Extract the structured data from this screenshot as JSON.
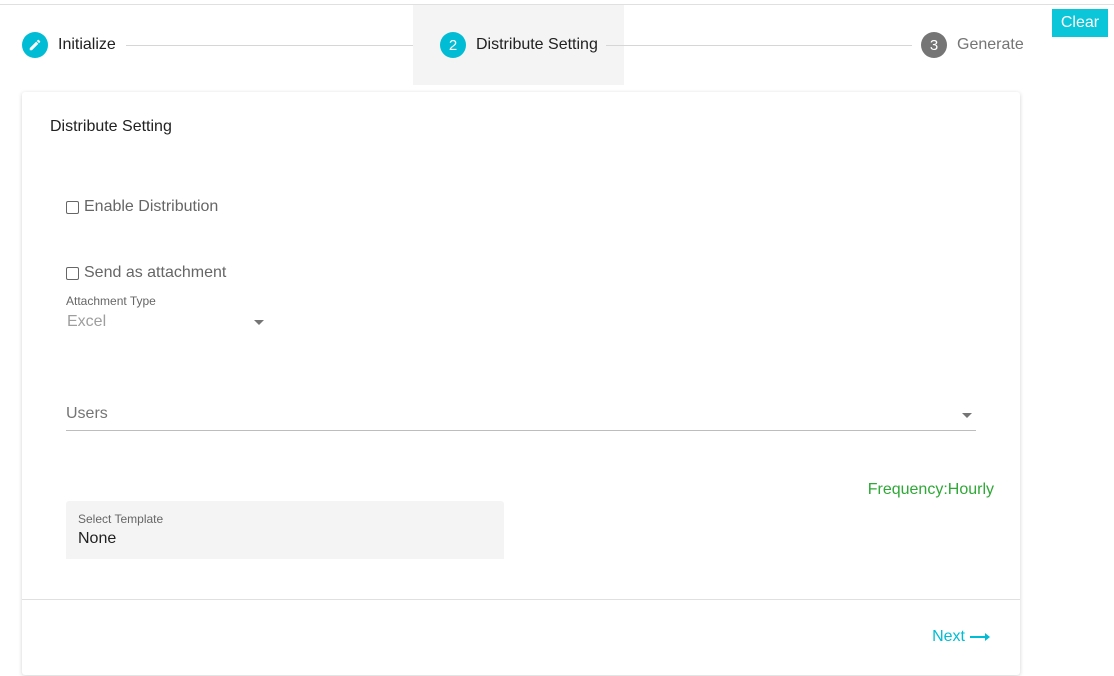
{
  "stepper": {
    "steps": [
      {
        "label": "Initialize",
        "badge": "",
        "icon": "pencil-icon",
        "state": "completed"
      },
      {
        "label": "Distribute Setting",
        "badge": "2",
        "state": "active"
      },
      {
        "label": "Generate",
        "badge": "3",
        "state": "inactive"
      }
    ]
  },
  "toolbar": {
    "clear_label": "Clear"
  },
  "card": {
    "title": "Distribute Setting",
    "enable_distribution": {
      "label": "Enable Distribution",
      "checked": false
    },
    "send_as_attachment": {
      "label": "Send as attachment",
      "checked": false
    },
    "attachment_type": {
      "label": "Attachment Type",
      "value": "Excel"
    },
    "users": {
      "placeholder": "Users"
    },
    "frequency": "Frequency:Hourly",
    "template": {
      "label": "Select Template",
      "value": "None"
    },
    "next_label": "Next"
  },
  "colors": {
    "accent": "#00bcd4",
    "clear_button": "#0bc5d8",
    "frequency": "#2ea836",
    "inactive_step": "#757575"
  }
}
